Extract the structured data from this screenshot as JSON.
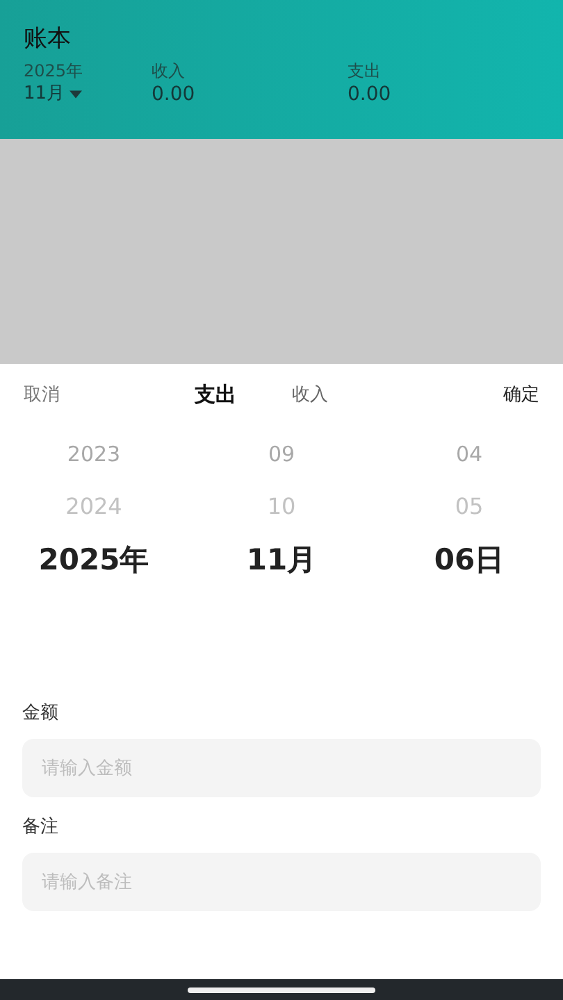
{
  "header": {
    "title": "账本",
    "year": "2025年",
    "month": "11月",
    "income_label": "收入",
    "income_value": "0.00",
    "expense_label": "支出",
    "expense_value": "0.00"
  },
  "sheet": {
    "cancel": "取消",
    "confirm": "确定",
    "tabs": [
      {
        "label": "支出",
        "selected": true
      },
      {
        "label": "收入",
        "selected": false
      }
    ],
    "picker": [
      {
        "items": [
          {
            "text": "2023",
            "selected": false
          },
          {
            "text": "2024",
            "selected": false
          },
          {
            "text": "2025年",
            "selected": true
          }
        ]
      },
      {
        "items": [
          {
            "text": "09",
            "selected": false
          },
          {
            "text": "10",
            "selected": false
          },
          {
            "text": "11月",
            "selected": true
          }
        ]
      },
      {
        "items": [
          {
            "text": "04",
            "selected": false
          },
          {
            "text": "05",
            "selected": false
          },
          {
            "text": "06日",
            "selected": true
          }
        ]
      }
    ],
    "fields": [
      {
        "label": "金额",
        "placeholder": "请输入金额"
      },
      {
        "label": "备注",
        "placeholder": "请输入备注"
      }
    ]
  }
}
